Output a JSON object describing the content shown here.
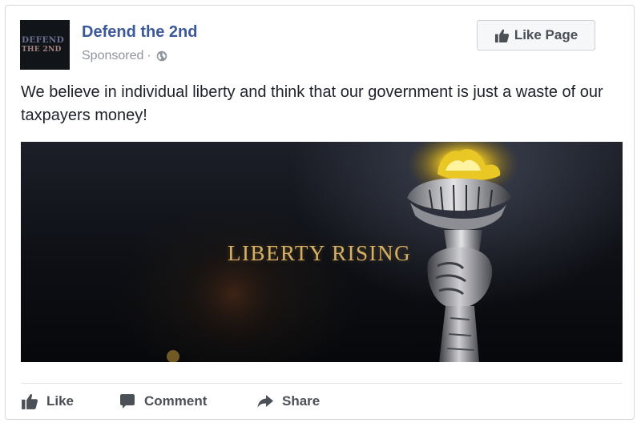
{
  "post": {
    "page_name": "Defend the 2nd",
    "sponsored_label": "Sponsored",
    "meta_separator": "·",
    "audience_icon": "globe-icon",
    "body_text": "We believe in individual liberty and think that our government is just a waste of our taxpayers money!",
    "avatar": {
      "line1": "DEFEND",
      "line2": "THE 2ND"
    },
    "like_page_button": {
      "label": "Like Page",
      "icon": "thumbs-up-icon"
    },
    "media": {
      "caption": "LIBERTY RISING"
    }
  },
  "actions": {
    "like_label": "Like",
    "comment_label": "Comment",
    "share_label": "Share"
  },
  "colors": {
    "page_name": "#3b5998",
    "meta_text": "#90949c",
    "action_text": "#4b4f56",
    "caption_gold": "#d6b066"
  }
}
